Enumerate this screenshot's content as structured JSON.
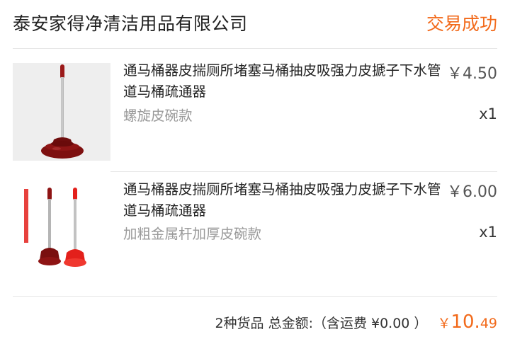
{
  "header": {
    "shop_name": "泰安家得净清洁用品有限公司",
    "status": "交易成功"
  },
  "items": [
    {
      "title": "通马桶器皮揣厕所堵塞马桶抽皮吸强力皮搋子下水管道马桶疏通器",
      "sku": "螺旋皮碗款",
      "price": "￥4.50",
      "qty": "x1"
    },
    {
      "title": "通马桶器皮揣厕所堵塞马桶抽皮吸强力皮搋子下水管道马桶疏通器",
      "sku": "加粗金属杆加厚皮碗款",
      "price": "￥6.00",
      "qty": "x1"
    }
  ],
  "summary": {
    "count_text": "2种货品",
    "total_label": "总金额:（含运费 ¥0.00 ）",
    "currency": "￥",
    "total_int": "10.",
    "total_dec": "49"
  },
  "colors": {
    "accent": "#f26a1b",
    "plunger_dark": "#8e1414",
    "plunger_red": "#e3201b"
  }
}
